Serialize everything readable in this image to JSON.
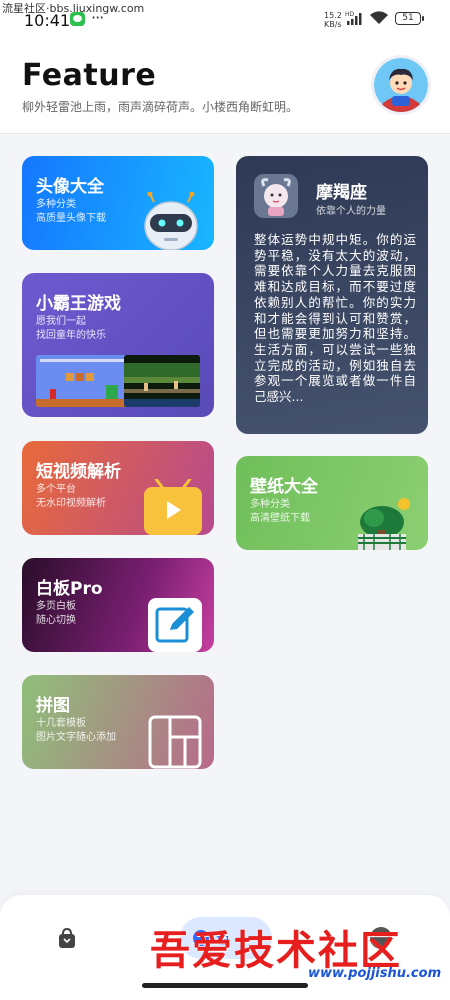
{
  "watermark_top": "流星社区·bbs.liuxingw.com",
  "status": {
    "time": "10:41",
    "net_speed": "15.2",
    "net_unit": "KB/s",
    "battery": "51"
  },
  "header": {
    "title": "Feature",
    "subtitle": "柳外轻雷池上雨，雨声滴碎荷声。小楼西角断虹明。"
  },
  "cards": {
    "avatar": {
      "title": "头像大全",
      "desc1": "多种分类",
      "desc2": "高质量头像下载"
    },
    "game": {
      "title": "小霸王游戏",
      "desc1": "愿我们一起",
      "desc2": "找回童年的快乐"
    },
    "video": {
      "title": "短视频解析",
      "desc1": "多个平台",
      "desc2": "无水印视频解析"
    },
    "whiteboard": {
      "title": "白板Pro",
      "desc1": "多页白板",
      "desc2": "随心切换"
    },
    "collage": {
      "title": "拼图",
      "desc1": "十几套模板",
      "desc2": "图片文字随心添加"
    },
    "horoscope": {
      "title": "摩羯座",
      "motto": "依靠个人的力量",
      "text": "整体运势中规中矩。你的运势平稳，没有太大的波动，需要依靠个人力量去克服困难和达成目标，而不要过度依赖别人的帮忙。你的实力和才能会得到认可和赞赏，但也需要更加努力和坚持。生活方面，可以尝试一些独立完成的活动，例如独自去参观一个展览或者做一件自己感兴..."
    },
    "wallpaper": {
      "title": "壁纸大全",
      "desc1": "多种分类",
      "desc2": "高清壁纸下载"
    }
  },
  "bottom_nav": {
    "active_label": "色"
  },
  "watermark": {
    "text": "吾爱技术社区",
    "url": "www.pojjishu.com"
  },
  "icons": [
    "wechat-icon",
    "more-dots-icon",
    "hd-signal-icon",
    "wifi-icon",
    "battery-icon",
    "robot-icon",
    "video-play-icon",
    "edit-icon",
    "layout-grid-icon",
    "capricorn-icon",
    "wallpaper-tree-icon",
    "bag-icon",
    "palette-icon"
  ],
  "colors": {
    "accent": "#2f6bff",
    "avatar_card": "#1577ff",
    "game_card": "#6e5ad0",
    "video_card": "#e86a3b",
    "whiteboard_card": "#7a1f72",
    "collage_card": "#8fc07a",
    "horoscope_card": "#2e3a55",
    "wallpaper_card": "#6fbf5a"
  }
}
